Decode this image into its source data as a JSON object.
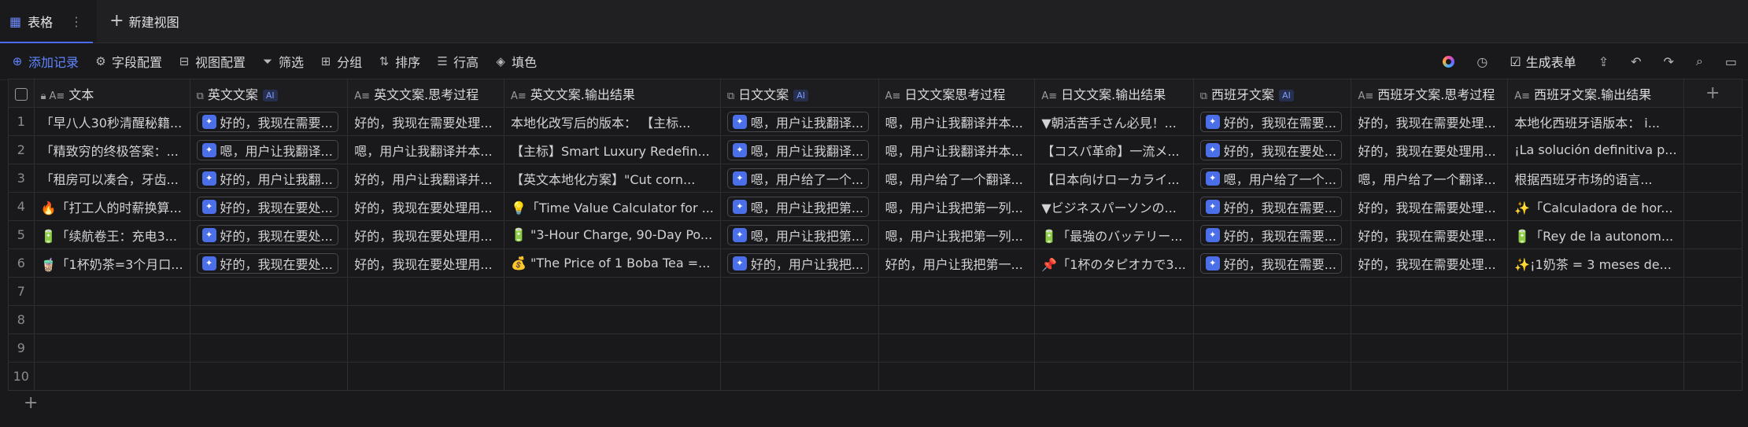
{
  "tabs": {
    "active_label": "表格",
    "more": "⋮",
    "new_view": "新建视图"
  },
  "toolbar": {
    "add_record": "添加记录",
    "field_config": "字段配置",
    "view_config": "视图配置",
    "filter": "筛选",
    "group": "分组",
    "sort": "排序",
    "row_height": "行高",
    "fill_color": "填色",
    "generate_form": "生成表单"
  },
  "columns": [
    {
      "label": "文本",
      "icon": "text-icon",
      "ai": false
    },
    {
      "label": "英文文案",
      "icon": "ai-generate-icon",
      "ai": true,
      "ai_label": "AI"
    },
    {
      "label": "英文文案.思考过程",
      "icon": "text-ai-icon",
      "ai": false
    },
    {
      "label": "英文文案.输出结果",
      "icon": "text-ai-icon",
      "ai": false
    },
    {
      "label": "日文文案",
      "icon": "ai-generate-icon",
      "ai": true,
      "ai_label": "AI"
    },
    {
      "label": "日文文案思考过程",
      "icon": "text-ai-icon",
      "ai": false
    },
    {
      "label": "日文文案.输出结果",
      "icon": "text-ai-icon",
      "ai": false
    },
    {
      "label": "西班牙文案",
      "icon": "ai-generate-icon",
      "ai": true,
      "ai_label": "AI"
    },
    {
      "label": "西班牙文案.思考过程",
      "icon": "text-ai-icon",
      "ai": false
    },
    {
      "label": "西班牙文案.输出结果",
      "icon": "text-ai-icon",
      "ai": false
    }
  ],
  "rows": [
    {
      "num": "1",
      "cells": [
        "「早八人30秒清醒秘籍...",
        "好的，我现在需要...",
        "好的，我现在需要处理...",
        "本地化改写后的版本： 【主标...",
        "嗯，用户让我翻译...",
        "嗯，用户让我翻译并本...",
        "▼朝活苦手さん必見！...",
        "好的，我现在需要...",
        "好的，我现在需要处理...",
        "本地化西班牙语版本： i..."
      ]
    },
    {
      "num": "2",
      "cells": [
        "「精致穷的终极答案：...",
        "嗯，用户让我翻译...",
        "嗯，用户让我翻译并本...",
        "【主标】Smart Luxury Redefin...",
        "嗯，用户让我翻译...",
        "嗯，用户让我翻译并本...",
        "【コスパ革命】一流メ...",
        "好的，我现在要处...",
        "好的，我现在要处理用...",
        "¡La solución definitiva p..."
      ]
    },
    {
      "num": "3",
      "cells": [
        "「租房可以凑合，牙齿...",
        "好的，用户让我翻...",
        "好的，用户让我翻译并...",
        "【英文本地化方案】\"Cut corn...",
        "嗯，用户给了一个...",
        "嗯，用户给了一个翻译...",
        "【日本向けローカライ...",
        "嗯，用户给了一个...",
        "嗯，用户给了一个翻译...",
        "根据西班牙市场的语言..."
      ]
    },
    {
      "num": "4",
      "cells": [
        "🔥「打工人的时薪换算...",
        "好的，我现在要处...",
        "好的，我现在要处理用...",
        "💡「Time Value Calculator for ...",
        "嗯，用户让我把第...",
        "嗯，用户让我把第一列...",
        "▼ビジネスパーソンの...",
        "好的，我现在需要...",
        "好的，我现在需要处理...",
        "✨「Calculadora de hor..."
      ]
    },
    {
      "num": "5",
      "cells": [
        "🔋「续航卷王：充电3...",
        "好的，我现在要处...",
        "好的，我现在要处理用...",
        "🔋 \"3-Hour Charge, 90-Day Po...",
        "嗯，用户让我把第...",
        "嗯，用户让我把第一列...",
        "🔋「最強のバッテリー...",
        "好的，我现在需要...",
        "好的，我现在需要处理...",
        "🔋「Rey de la autonom..."
      ]
    },
    {
      "num": "6",
      "cells": [
        "🧋「1杯奶茶=3个月口...",
        "好的，我现在要处...",
        "好的，我现在要处理用...",
        "💰 \"The Price of 1 Boba Tea =...",
        "好的，用户让我把...",
        "好的，用户让我把第一...",
        "📌「1杯のタピオカで3...",
        "好的，我现在需要...",
        "好的，我现在需要处理...",
        "✨¡1奶茶 = 3 meses de..."
      ]
    }
  ],
  "empty_rows": [
    "7",
    "8",
    "9",
    "10"
  ],
  "add_column": "+",
  "add_row": "+"
}
